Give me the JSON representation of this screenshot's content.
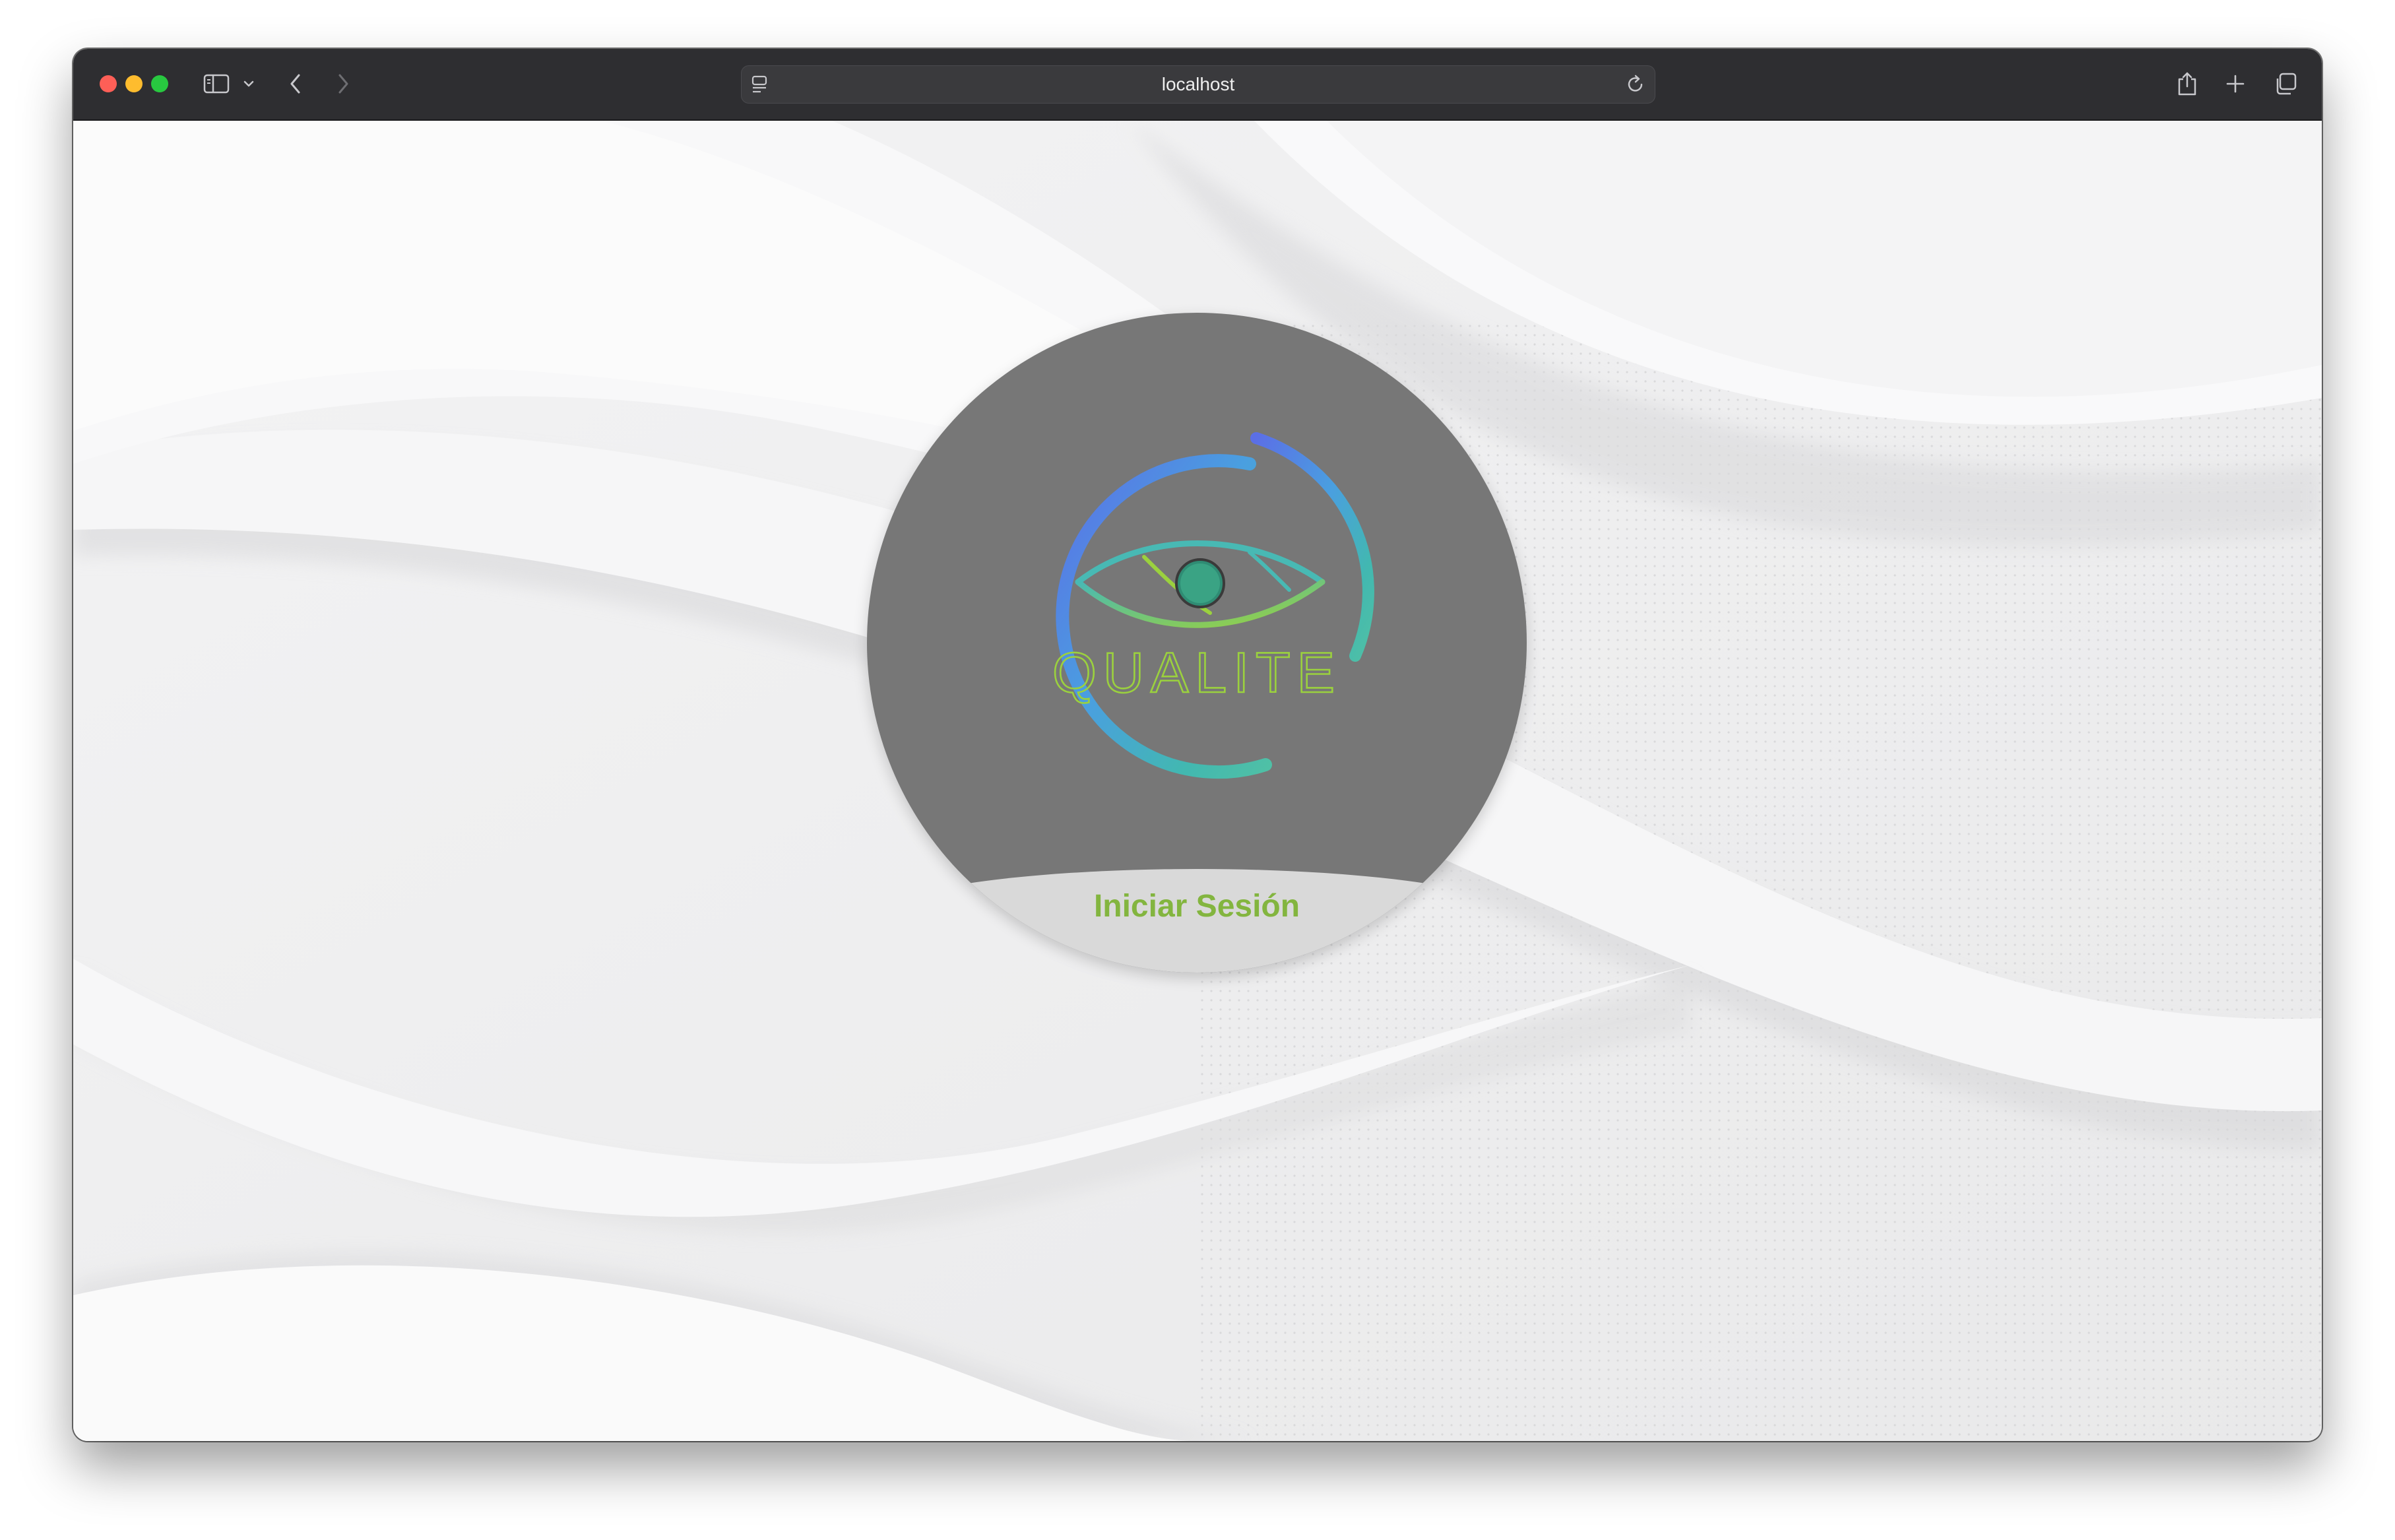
{
  "browser": {
    "url": "localhost"
  },
  "logo": {
    "brand_text": "QUALITE"
  },
  "login": {
    "label": "Iniciar Sesión"
  },
  "colors": {
    "toolbar": "#2e2e31",
    "logo_circle": "#777777",
    "login_cap": "#d9d9d9",
    "accent_green": "#83b53f",
    "arc_blue": "#4f72e0",
    "arc_teal": "#43b9b3"
  },
  "icons": {
    "sidebar": "sidebar-toggle-icon",
    "back": "chevron-left-icon",
    "forward": "chevron-right-icon",
    "reload": "reload-icon",
    "share": "share-icon",
    "new_tab": "plus-icon",
    "tabs": "tab-overview-icon"
  }
}
